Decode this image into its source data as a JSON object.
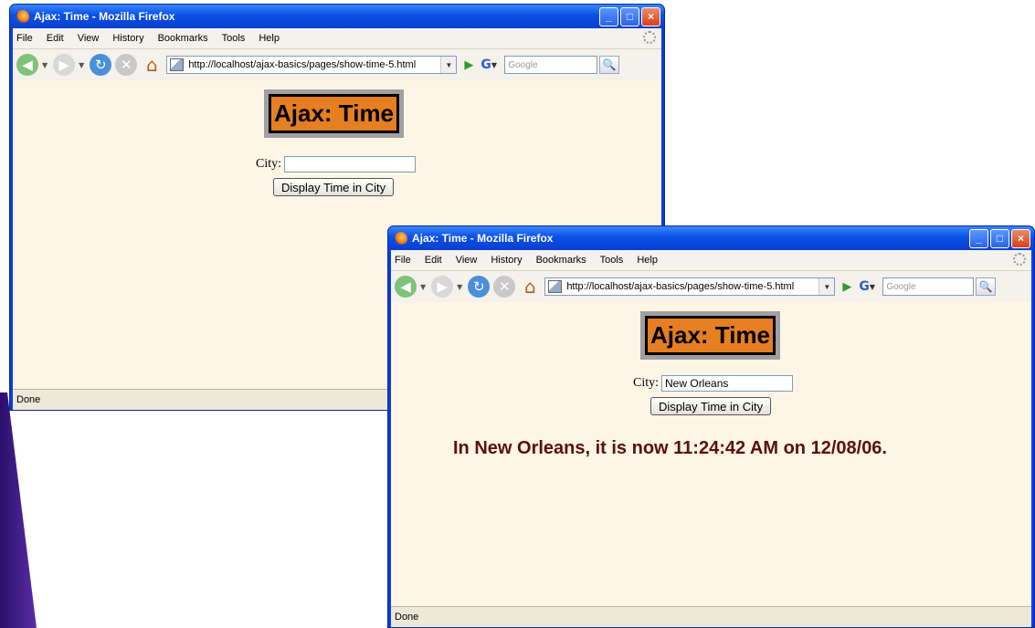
{
  "window1": {
    "title": "Ajax: Time - Mozilla Firefox",
    "menu": [
      "File",
      "Edit",
      "View",
      "History",
      "Bookmarks",
      "Tools",
      "Help"
    ],
    "url": "http://localhost/ajax-basics/pages/show-time-5.html",
    "search_placeholder": "Google",
    "page_title": "Ajax: Time",
    "city_label": "City:",
    "city_value": "",
    "button_label": "Display Time in City",
    "status": "Done"
  },
  "window2": {
    "title": "Ajax: Time - Mozilla Firefox",
    "menu": [
      "File",
      "Edit",
      "View",
      "History",
      "Bookmarks",
      "Tools",
      "Help"
    ],
    "url": "http://localhost/ajax-basics/pages/show-time-5.html",
    "search_placeholder": "Google",
    "page_title": "Ajax: Time",
    "city_label": "City:",
    "city_value": "New Orleans",
    "button_label": "Display Time in City",
    "result": "In New Orleans, it is now 11:24:42 AM on 12/08/06.",
    "status": "Done"
  },
  "colors": {
    "title_bg": "#e67e22",
    "page_bg": "#fdf5e6",
    "result_text": "#5a0f0f",
    "xp_title": "#0a50e6"
  }
}
